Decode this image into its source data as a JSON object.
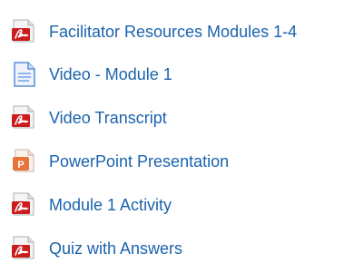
{
  "resources": [
    {
      "label": "Facilitator Resources Modules 1-4",
      "icon": "pdf-icon"
    },
    {
      "label": "Video - Module 1",
      "icon": "document-icon"
    },
    {
      "label": "Video Transcript",
      "icon": "pdf-icon"
    },
    {
      "label": "PowerPoint Presentation",
      "icon": "powerpoint-icon"
    },
    {
      "label": "Module 1 Activity",
      "icon": "pdf-icon"
    },
    {
      "label": "Quiz with Answers",
      "icon": "pdf-icon"
    }
  ],
  "colors": {
    "link": "#1a63ad",
    "pdf_red": "#cc1d1d",
    "powerpoint_orange": "#e8743b",
    "document_blue": "#5b8fd6"
  }
}
